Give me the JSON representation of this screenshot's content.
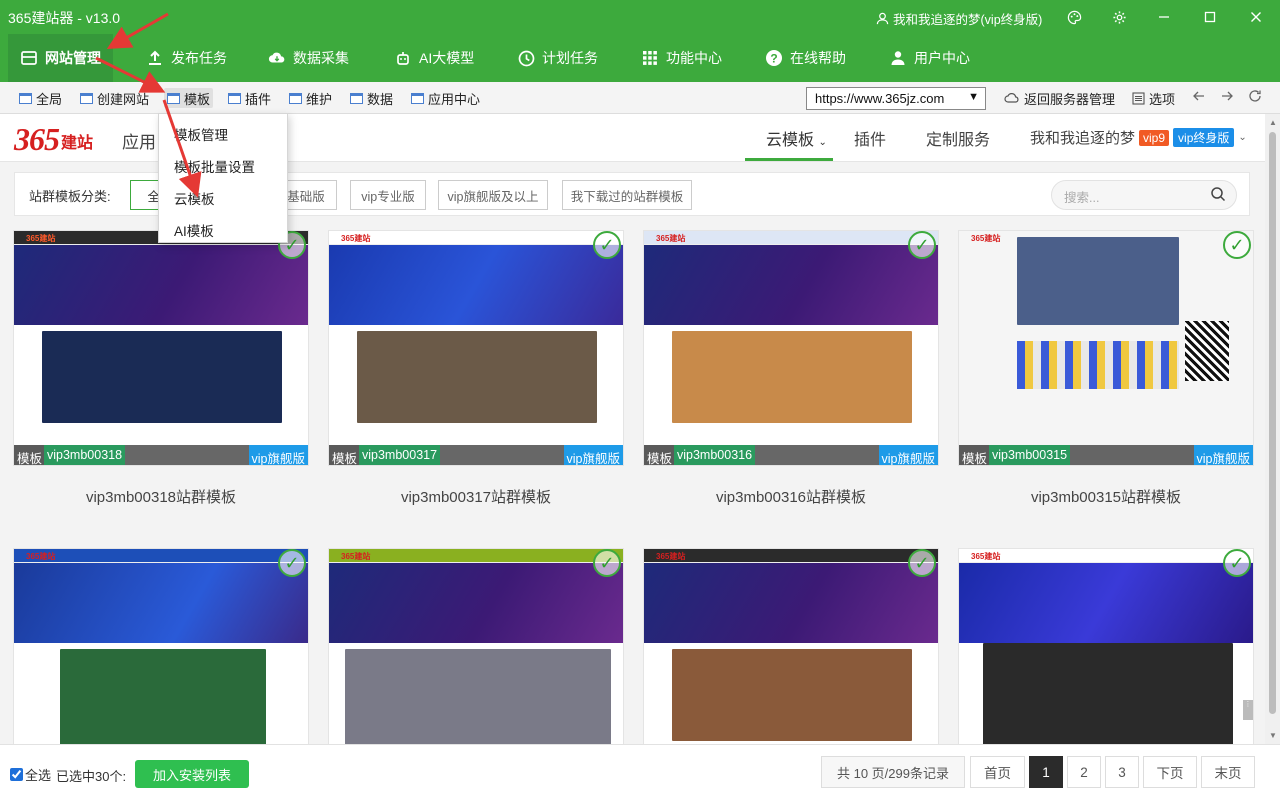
{
  "window": {
    "title": "365建站器 - v13.0",
    "user": "我和我追逐的梦(vip终身版)",
    "accent": "#3daa3d"
  },
  "nav": {
    "items": [
      {
        "label": "网站管理",
        "icon": "website-icon"
      },
      {
        "label": "发布任务",
        "icon": "upload-icon"
      },
      {
        "label": "数据采集",
        "icon": "cloud-download-icon"
      },
      {
        "label": "AI大模型",
        "icon": "robot-icon"
      },
      {
        "label": "计划任务",
        "icon": "clock-icon"
      },
      {
        "label": "功能中心",
        "icon": "grid-icon"
      },
      {
        "label": "在线帮助",
        "icon": "help-icon"
      },
      {
        "label": "用户中心",
        "icon": "user-icon"
      }
    ]
  },
  "toolbar": {
    "items": [
      "全局",
      "创建网站",
      "模板",
      "插件",
      "维护",
      "数据",
      "应用中心"
    ],
    "url": "https://www.365jz.com",
    "back_server": "返回服务器管理",
    "options": "选项"
  },
  "dropdown": {
    "items": [
      "模板管理",
      "模板批量设置",
      "云模板",
      "AI模板"
    ]
  },
  "header": {
    "logo_num": "365",
    "logo_text": "建站",
    "app_center": "应用",
    "tabs": [
      "云模板",
      "插件",
      "定制服务"
    ],
    "username": "我和我追逐的梦",
    "vip_badge": "vip9",
    "vip_life": "vip终身版"
  },
  "filter": {
    "label": "站群模板分类:",
    "buttons": [
      "全部",
      "基础版",
      "vip专业版",
      "vip旗舰版及以上",
      "我下载过的站群模板"
    ],
    "search_placeholder": "搜索..."
  },
  "cards": [
    {
      "type": "模板",
      "code": "vip3mb00318",
      "level": "vip旗舰版",
      "title": "vip3mb00318站群模板",
      "checked": true,
      "photo_color": "#1a2b55"
    },
    {
      "type": "模板",
      "code": "vip3mb00317",
      "level": "vip旗舰版",
      "title": "vip3mb00317站群模板",
      "checked": true,
      "photo_color": "#6b5a48"
    },
    {
      "type": "模板",
      "code": "vip3mb00316",
      "level": "vip旗舰版",
      "title": "vip3mb00316站群模板",
      "checked": true,
      "photo_color": "#c88a4a"
    },
    {
      "type": "模板",
      "code": "vip3mb00315",
      "level": "vip旗舰版",
      "title": "vip3mb00315站群模板",
      "checked": true,
      "photo_color": "#4b5f8a"
    },
    {
      "checked": true,
      "photo_color": "#2a6a3a"
    },
    {
      "checked": true,
      "photo_color": "#7a7a88"
    },
    {
      "checked": true,
      "photo_color": "#8a5a3a"
    },
    {
      "checked": true,
      "photo_color": "#2a2a2a"
    }
  ],
  "footer": {
    "select_all": "全选",
    "selected": "已选中30个:",
    "add_button": "加入安装列表",
    "summary": "共 10 页/299条记录",
    "first": "首页",
    "pages": [
      "1",
      "2",
      "3"
    ],
    "next": "下页",
    "last": "末页"
  }
}
